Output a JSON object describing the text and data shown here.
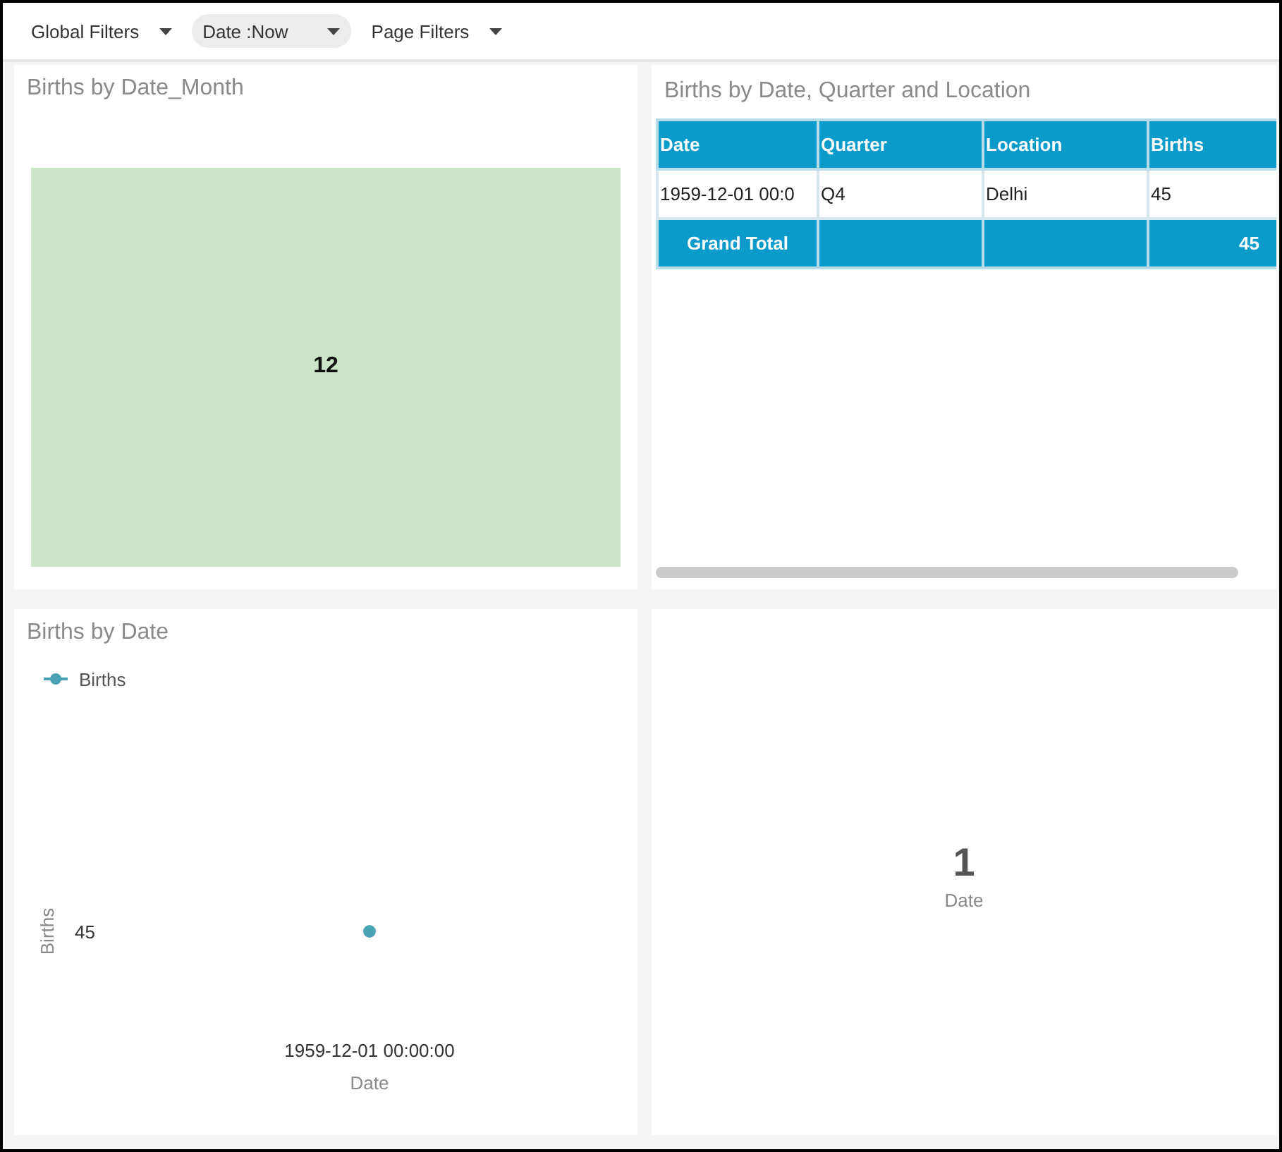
{
  "filters": [
    {
      "label": "Global Filters",
      "highlighted": false
    },
    {
      "label": "Date :Now",
      "highlighted": true
    },
    {
      "label": "Page Filters",
      "highlighted": false
    }
  ],
  "treemap_panel": {
    "title": "Births by Date_Month",
    "tiles": [
      {
        "label": "12",
        "color": "#cce5c8"
      }
    ]
  },
  "table_panel": {
    "title": "Births by Date, Quarter and Location",
    "columns": [
      "Date",
      "Quarter",
      "Location",
      "Births"
    ],
    "rows": [
      [
        "1959-12-01 00:0",
        "Q4",
        "Delhi",
        "45"
      ]
    ],
    "total_row": {
      "label": "Grand Total",
      "births": "45"
    }
  },
  "chart_panel": {
    "title": "Births by Date",
    "legend": {
      "label": "Births",
      "color": "#4aa3b5"
    },
    "y_axis_title": "Births",
    "y_value_label": "45",
    "x_value_label": "1959-12-01 00:00:00",
    "x_axis_title": "Date"
  },
  "kpi_panel": {
    "value": "1",
    "label": "Date"
  }
}
